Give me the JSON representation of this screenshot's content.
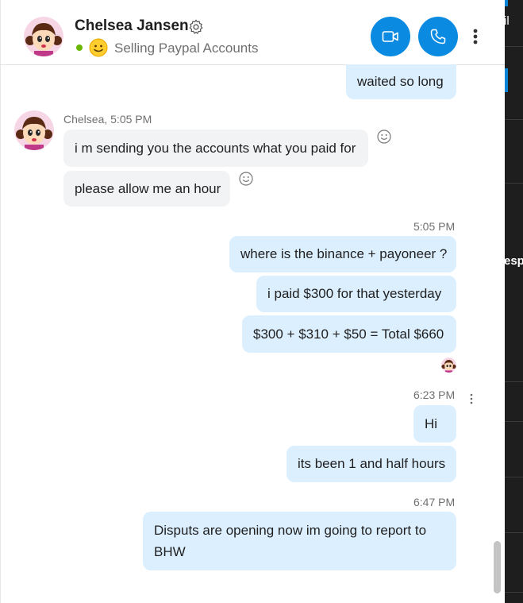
{
  "header": {
    "contact_name": "Chelsea Jansen",
    "mood_message": "Selling Paypal Accounts",
    "status_color": "#6bb700",
    "video_call_icon": "video-camera-icon",
    "audio_call_icon": "phone-icon",
    "settings_icon": "gear-icon",
    "more_icon": "more-vertical-icon"
  },
  "messages": [
    {
      "id": "m0",
      "direction": "out",
      "text": "waited so long"
    },
    {
      "id": "m1",
      "direction": "in",
      "sender_meta": "Chelsea, 5:05 PM",
      "text": "i m sending you the accounts what you paid for"
    },
    {
      "id": "m2",
      "direction": "in",
      "text": "please allow me an hour"
    },
    {
      "id": "m3",
      "direction": "out",
      "timestamp": "5:05 PM",
      "text": "where is the binance + payoneer ?"
    },
    {
      "id": "m4",
      "direction": "out",
      "text": "i paid $300 for that yesterday"
    },
    {
      "id": "m5",
      "direction": "out",
      "text": "$300 + $310 + $50 = Total $660"
    },
    {
      "id": "m6",
      "direction": "out",
      "timestamp": "6:23 PM",
      "text": "Hi"
    },
    {
      "id": "m7",
      "direction": "out",
      "text": "its been 1 and half hours"
    },
    {
      "id": "m8",
      "direction": "out",
      "timestamp": "6:47 PM",
      "text_line1": "Disputs are opening now im going to report to",
      "text_line2": "BHW"
    }
  ],
  "right_panel": {
    "text_top": "il",
    "text_mid": "esp"
  },
  "colors": {
    "accent": "#0a8ae0",
    "outgoing_bubble": "#dcefff",
    "incoming_bubble": "#f1f3f5"
  }
}
